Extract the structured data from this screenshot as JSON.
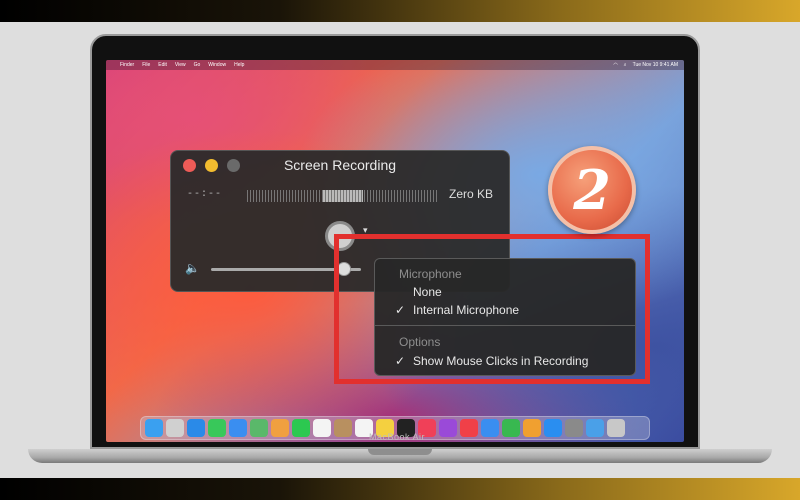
{
  "menubar": {
    "apple": "",
    "items": [
      "Finder",
      "File",
      "Edit",
      "View",
      "Go",
      "Window",
      "Help"
    ],
    "clock": "Tue Nov 10 9:41 AM"
  },
  "recording_window": {
    "title": "Screen Recording",
    "time": "--:--",
    "size": "Zero KB"
  },
  "options_menu": {
    "microphone_header": "Microphone",
    "mic_none": "None",
    "mic_internal": "Internal Microphone",
    "options_header": "Options",
    "show_clicks": "Show Mouse Clicks in Recording",
    "check": "✓"
  },
  "badge": {
    "number": "2"
  },
  "device": {
    "label": "MacBook Air"
  },
  "colors": {
    "highlight": "#e2302e",
    "badge": "#e86a4a"
  },
  "dock": {
    "icons": [
      {
        "name": "finder-icon",
        "color": "#3aa0f0"
      },
      {
        "name": "launchpad-icon",
        "color": "#d0d0d0"
      },
      {
        "name": "safari-icon",
        "color": "#2a8ae8"
      },
      {
        "name": "messages-icon",
        "color": "#38c85a"
      },
      {
        "name": "mail-icon",
        "color": "#3a8ef0"
      },
      {
        "name": "maps-icon",
        "color": "#5ab86a"
      },
      {
        "name": "photos-icon",
        "color": "#f0a040"
      },
      {
        "name": "facetime-icon",
        "color": "#2cc850"
      },
      {
        "name": "calendar-icon",
        "color": "#f4f4f4"
      },
      {
        "name": "contacts-icon",
        "color": "#b89060"
      },
      {
        "name": "reminders-icon",
        "color": "#f4f4f4"
      },
      {
        "name": "notes-icon",
        "color": "#f4d040"
      },
      {
        "name": "tv-icon",
        "color": "#222222"
      },
      {
        "name": "music-icon",
        "color": "#f04058"
      },
      {
        "name": "podcasts-icon",
        "color": "#9a4ad8"
      },
      {
        "name": "news-icon",
        "color": "#f04048"
      },
      {
        "name": "keynote-icon",
        "color": "#3a8ef0"
      },
      {
        "name": "numbers-icon",
        "color": "#38b850"
      },
      {
        "name": "pages-icon",
        "color": "#f0a030"
      },
      {
        "name": "app-store-icon",
        "color": "#2a8ef0"
      },
      {
        "name": "system-preferences-icon",
        "color": "#8a8a8a"
      },
      {
        "name": "downloads-icon",
        "color": "#4aa0e8"
      },
      {
        "name": "trash-icon",
        "color": "#c8c8c8"
      }
    ]
  }
}
